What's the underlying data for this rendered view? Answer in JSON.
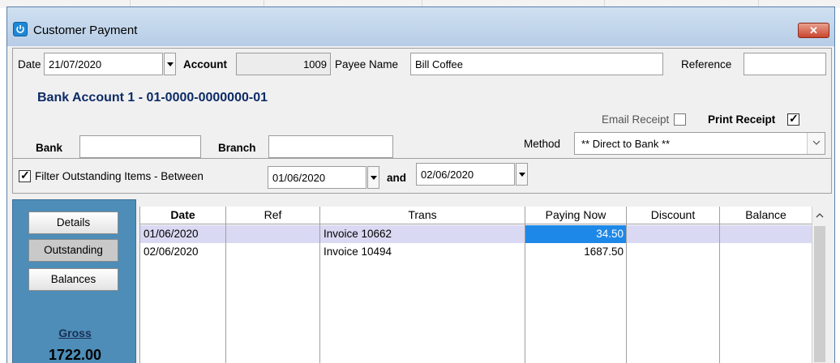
{
  "window": {
    "title": "Customer Payment",
    "close": "✕"
  },
  "header": {
    "date_label": "Date",
    "date_value": "21/07/2020",
    "account_label": "Account",
    "account_value": "1009",
    "payee_label": "Payee Name",
    "payee_value": "Bill Coffee",
    "reference_label": "Reference",
    "reference_value": ""
  },
  "bank": {
    "title": "Bank Account 1 - 01-0000-0000000-01",
    "email_receipt_label": "Email Receipt",
    "email_receipt_checked": false,
    "print_receipt_label": "Print Receipt",
    "print_receipt_checked": true,
    "bank_label": "Bank",
    "bank_value": "",
    "branch_label": "Branch",
    "branch_value": "",
    "method_label": "Method",
    "method_value": "** Direct to Bank **"
  },
  "filter": {
    "checked": true,
    "label": "Filter Outstanding Items -  Between",
    "from": "01/06/2020",
    "and_label": "and",
    "to": "02/06/2020"
  },
  "sidebar": {
    "buttons": [
      "Details",
      "Outstanding",
      "Balances"
    ],
    "active": "Outstanding",
    "gross_label": "Gross",
    "gross_value": "1722.00"
  },
  "grid": {
    "columns": [
      "Date",
      "Ref",
      "Trans",
      "Paying Now",
      "Discount",
      "Balance"
    ],
    "rows": [
      {
        "date": "01/06/2020",
        "ref": "",
        "trans": "Invoice 10662",
        "paying_now": "34.50",
        "discount": "",
        "balance": ""
      },
      {
        "date": "02/06/2020",
        "ref": "",
        "trans": "Invoice 10494",
        "paying_now": "1687.50",
        "discount": "",
        "balance": ""
      }
    ]
  },
  "colors": {
    "title_bar": "#b7cde6",
    "bank_title": "#0d2b66",
    "sidebar": "#4d8db8",
    "selected_row": "#d9d9f3",
    "highlight_cell": "#1e88e8"
  }
}
